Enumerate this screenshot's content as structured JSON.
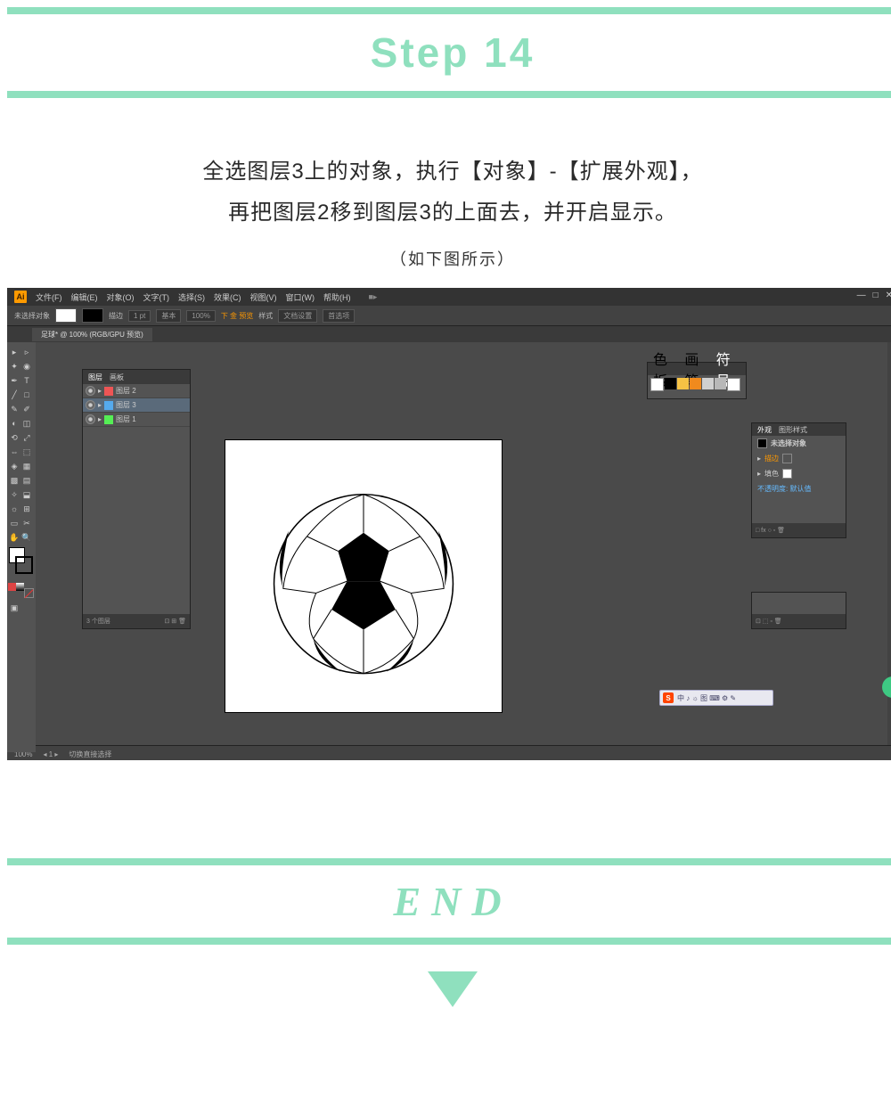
{
  "step": {
    "title": "Step 14",
    "instruction_line1": "全选图层3上的对象，执行【对象】-【扩展外观】，",
    "instruction_line2": "再把图层2移到图层3的上面去，并开启显示。",
    "note": "（如下图所示）"
  },
  "illustrator": {
    "logo": "Ai",
    "menu": [
      "文件(F)",
      "编辑(E)",
      "对象(O)",
      "文字(T)",
      "选择(S)",
      "效果(C)",
      "视图(V)",
      "窗口(W)",
      "帮助(H)"
    ],
    "control": {
      "noSelection": "未选择对象",
      "fill": "填色",
      "stroke": "描边",
      "pt": "1 pt",
      "uniform": "基本",
      "opacity": "100%",
      "style": "样式",
      "docSetup": "文档设置",
      "prefs": "首选项"
    },
    "tab": "足球* @ 100% (RGB/GPU 预览)",
    "layersPanel": {
      "tabs": [
        "图层",
        "画板"
      ],
      "rows": [
        {
          "name": "图层 2"
        },
        {
          "name": "图层 3"
        },
        {
          "name": "图层 1"
        }
      ],
      "footer": "3 个图层"
    },
    "appearancePanel": {
      "tabs": [
        "外观",
        "图形样式"
      ],
      "title": "未选择对象",
      "rows": [
        {
          "label": "描边"
        },
        {
          "label": "填色"
        },
        {
          "label": "不透明度: 默认值"
        }
      ]
    },
    "swatches": [
      "#fff",
      "#000",
      "#f6c244",
      "#f08a1d",
      "#d0d0d0",
      "#b8b8b8",
      "#8899aa"
    ],
    "status": {
      "zoom": "100%",
      "info": "切换直接选择"
    },
    "ime": {
      "s": "S",
      "text": "中 ♪ ☼ 图 ⌨ ⚙ ✎"
    }
  },
  "end": {
    "title": "END"
  },
  "colors": {
    "accent": "#8fe0be"
  }
}
